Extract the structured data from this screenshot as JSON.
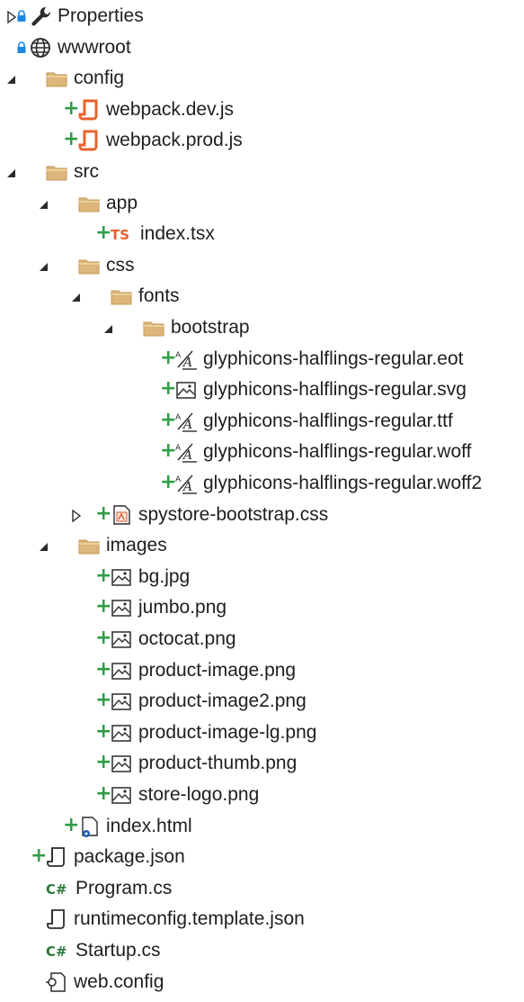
{
  "tree": [
    {
      "label": "Properties",
      "depth": 0,
      "expander": "collapsed",
      "icon": "wrench-icon",
      "lock": true,
      "plus": false
    },
    {
      "label": "wwwroot",
      "depth": 0,
      "expander": "none",
      "icon": "globe-icon",
      "lock": true,
      "plus": false
    },
    {
      "label": "config",
      "depth": 0,
      "expander": "expanded",
      "icon": "folder-icon",
      "lock": false,
      "plus": false
    },
    {
      "label": "webpack.dev.js",
      "depth": 1,
      "expander": "none",
      "icon": "js-file-icon",
      "lock": false,
      "plus": true
    },
    {
      "label": "webpack.prod.js",
      "depth": 1,
      "expander": "none",
      "icon": "js-file-icon",
      "lock": false,
      "plus": true
    },
    {
      "label": "src",
      "depth": 0,
      "expander": "expanded",
      "icon": "folder-icon",
      "lock": false,
      "plus": false
    },
    {
      "label": "app",
      "depth": 1,
      "expander": "expanded",
      "icon": "folder-icon",
      "lock": false,
      "plus": false
    },
    {
      "label": "index.tsx",
      "depth": 2,
      "expander": "none",
      "icon": "typescript-icon",
      "lock": false,
      "plus": true
    },
    {
      "label": "css",
      "depth": 1,
      "expander": "expanded",
      "icon": "folder-icon",
      "lock": false,
      "plus": false
    },
    {
      "label": "fonts",
      "depth": 2,
      "expander": "expanded",
      "icon": "folder-icon",
      "lock": false,
      "plus": false
    },
    {
      "label": "bootstrap",
      "depth": 3,
      "expander": "expanded",
      "icon": "folder-icon",
      "lock": false,
      "plus": false
    },
    {
      "label": "glyphicons-halflings-regular.eot",
      "depth": 4,
      "expander": "none",
      "icon": "font-file-icon",
      "lock": false,
      "plus": true
    },
    {
      "label": "glyphicons-halflings-regular.svg",
      "depth": 4,
      "expander": "none",
      "icon": "image-file-icon",
      "lock": false,
      "plus": true
    },
    {
      "label": "glyphicons-halflings-regular.ttf",
      "depth": 4,
      "expander": "none",
      "icon": "font-file-icon",
      "lock": false,
      "plus": true
    },
    {
      "label": "glyphicons-halflings-regular.woff",
      "depth": 4,
      "expander": "none",
      "icon": "font-file-icon",
      "lock": false,
      "plus": true
    },
    {
      "label": "glyphicons-halflings-regular.woff2",
      "depth": 4,
      "expander": "none",
      "icon": "font-file-icon",
      "lock": false,
      "plus": true
    },
    {
      "label": "spystore-bootstrap.css",
      "depth": 2,
      "expander": "collapsed",
      "icon": "css-file-icon",
      "lock": false,
      "plus": true
    },
    {
      "label": "images",
      "depth": 1,
      "expander": "expanded",
      "icon": "folder-icon",
      "lock": false,
      "plus": false
    },
    {
      "label": "bg.jpg",
      "depth": 2,
      "expander": "none",
      "icon": "image-file-icon",
      "lock": false,
      "plus": true
    },
    {
      "label": "jumbo.png",
      "depth": 2,
      "expander": "none",
      "icon": "image-file-icon",
      "lock": false,
      "plus": true
    },
    {
      "label": "octocat.png",
      "depth": 2,
      "expander": "none",
      "icon": "image-file-icon",
      "lock": false,
      "plus": true
    },
    {
      "label": "product-image.png",
      "depth": 2,
      "expander": "none",
      "icon": "image-file-icon",
      "lock": false,
      "plus": true
    },
    {
      "label": "product-image2.png",
      "depth": 2,
      "expander": "none",
      "icon": "image-file-icon",
      "lock": false,
      "plus": true
    },
    {
      "label": "product-image-lg.png",
      "depth": 2,
      "expander": "none",
      "icon": "image-file-icon",
      "lock": false,
      "plus": true
    },
    {
      "label": "product-thumb.png",
      "depth": 2,
      "expander": "none",
      "icon": "image-file-icon",
      "lock": false,
      "plus": true
    },
    {
      "label": "store-logo.png",
      "depth": 2,
      "expander": "none",
      "icon": "image-file-icon",
      "lock": false,
      "plus": true
    },
    {
      "label": "index.html",
      "depth": 1,
      "expander": "none",
      "icon": "html-file-icon",
      "lock": false,
      "plus": true
    },
    {
      "label": "package.json",
      "depth": 0,
      "expander": "none",
      "icon": "json-file-icon",
      "lock": false,
      "plus": true
    },
    {
      "label": "Program.cs",
      "depth": 0,
      "expander": "none",
      "icon": "csharp-icon",
      "lock": false,
      "plus": false
    },
    {
      "label": "runtimeconfig.template.json",
      "depth": 0,
      "expander": "none",
      "icon": "json-file-icon",
      "lock": false,
      "plus": false
    },
    {
      "label": "Startup.cs",
      "depth": 0,
      "expander": "none",
      "icon": "csharp-icon",
      "lock": false,
      "plus": false
    },
    {
      "label": "web.config",
      "depth": 0,
      "expander": "none",
      "icon": "config-file-icon",
      "lock": false,
      "plus": false
    }
  ],
  "colors": {
    "folder": "#dcb67a",
    "added": "#2f9e47",
    "js": "#e8602c",
    "typescript": "#e8602c",
    "csharp": "#2b7a3b",
    "lock": "#1e88e5",
    "html": "#1e5fb4"
  }
}
